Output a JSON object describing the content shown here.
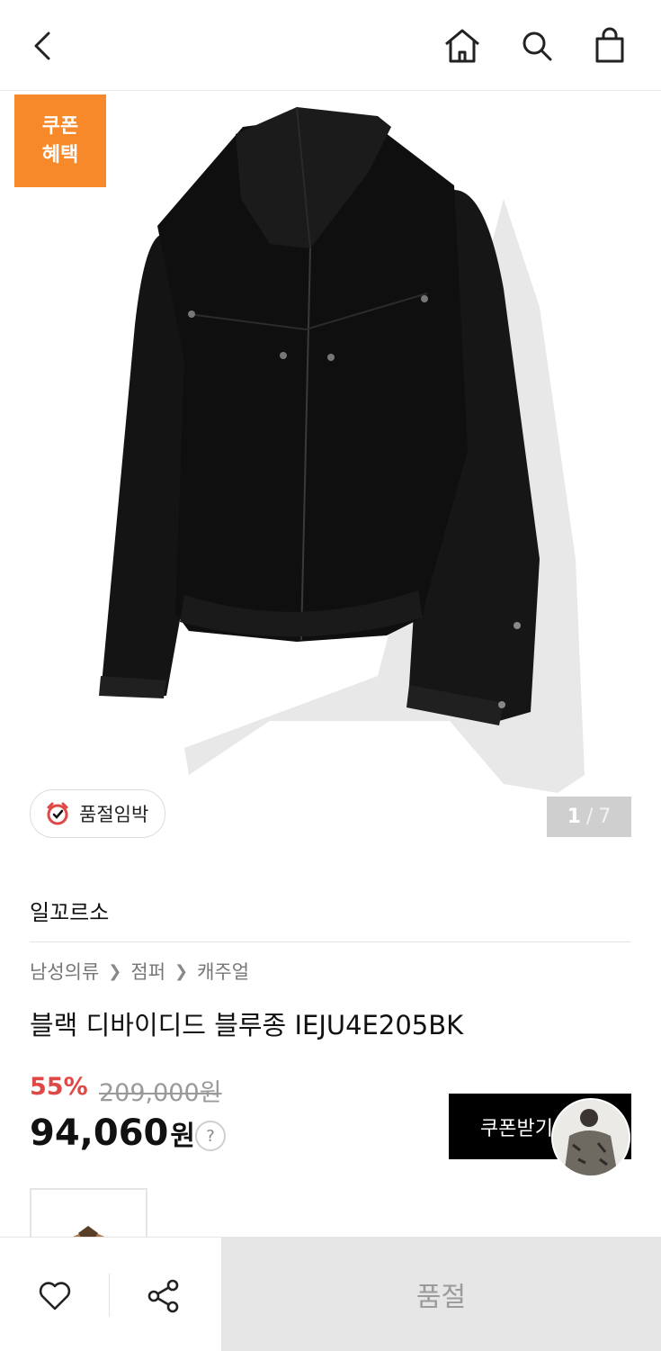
{
  "icons": {
    "back": "chevron-left-icon",
    "home": "home-icon",
    "search": "search-icon",
    "cart": "shopping-bag-icon",
    "alarm": "alarm-clock-icon",
    "wishlist": "heart-icon",
    "share": "share-icon"
  },
  "gallery": {
    "coupon_tag_line1": "쿠폰",
    "coupon_tag_line2": "혜택",
    "soldout_chip": "품절임박",
    "page_current": "1",
    "page_sep": "/",
    "page_total": "7"
  },
  "product": {
    "brand": "일꼬르소",
    "breadcrumb": [
      "남성의류",
      "점퍼",
      "캐주얼"
    ],
    "title": "블랙 디바이디드 블루종 IEJU4E205BK",
    "discount": "55%",
    "original_price": "209,000원",
    "price_number": "94,060",
    "price_unit": "원",
    "price_help": "?",
    "coupon_button": "쿠폰받기"
  },
  "bottom_bar": {
    "soldout_label": "품절"
  },
  "colors": {
    "coupon_orange": "#f7892a",
    "discount_red": "#e04848",
    "soldout_gray": "#e6e6e6"
  }
}
